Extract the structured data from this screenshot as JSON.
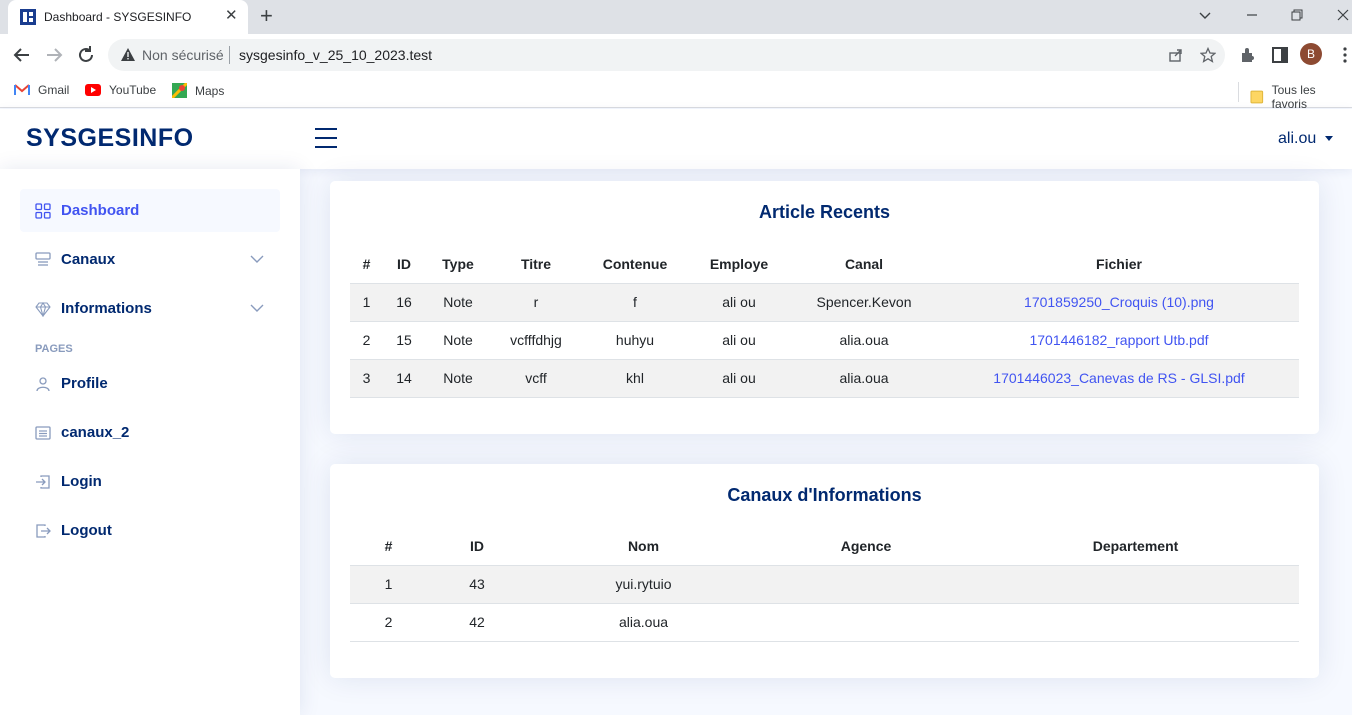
{
  "browser": {
    "tab_title": "Dashboard - SYSGESINFO",
    "security_label": "Non sécurisé",
    "url": "sysgesinfo_v_25_10_2023.test",
    "profile_initial": "B",
    "bookmarks": [
      "Gmail",
      "YouTube",
      "Maps"
    ],
    "all_bookmarks": "Tous les favoris"
  },
  "header": {
    "logo": "SYSGESINFO",
    "user": "ali.ou"
  },
  "sidebar": {
    "items": [
      {
        "label": "Dashboard",
        "icon": "grid-icon"
      },
      {
        "label": "Canaux",
        "icon": "menu-button-icon"
      },
      {
        "label": "Informations",
        "icon": "gem-icon"
      }
    ],
    "pages_heading": "PAGES",
    "pages": [
      {
        "label": "Profile",
        "icon": "person-icon"
      },
      {
        "label": "canaux_2",
        "icon": "card-list-icon"
      },
      {
        "label": "Login",
        "icon": "box-arrow-in-right-icon"
      },
      {
        "label": "Logout",
        "icon": "box-arrow-right-icon"
      }
    ]
  },
  "articles": {
    "title": "Article Recents",
    "columns": [
      "#",
      "ID",
      "Type",
      "Titre",
      "Contenue",
      "Employe",
      "Canal",
      "Fichier"
    ],
    "rows": [
      [
        "1",
        "16",
        "Note",
        "r",
        "f",
        "ali ou",
        "Spencer.Kevon",
        "1701859250_Croquis (10).png"
      ],
      [
        "2",
        "15",
        "Note",
        "vcfffdhjg",
        "huhyu",
        "ali ou",
        "alia.oua",
        "1701446182_rapport Utb.pdf"
      ],
      [
        "3",
        "14",
        "Note",
        "vcff",
        "khl",
        "ali ou",
        "alia.oua",
        "1701446023_Canevas de RS - GLSI.pdf"
      ]
    ]
  },
  "canaux": {
    "title": "Canaux d'Informations",
    "columns": [
      "#",
      "ID",
      "Nom",
      "Agence",
      "Departement"
    ],
    "rows": [
      [
        "1",
        "43",
        "yui.rytuio",
        "",
        ""
      ],
      [
        "2",
        "42",
        "alia.oua",
        "",
        ""
      ]
    ]
  },
  "colors": {
    "brand": "#012970",
    "accent": "#4154f1",
    "page_bg": "#f6f9ff"
  }
}
